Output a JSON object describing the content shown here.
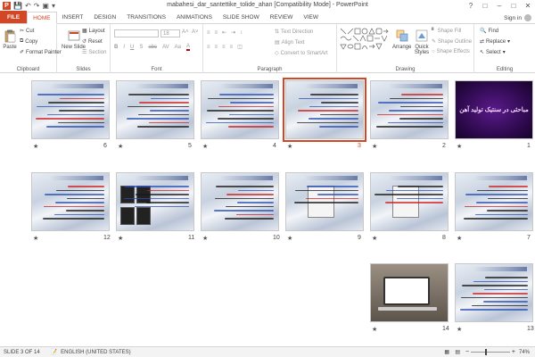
{
  "window": {
    "title": "mabahesi_dar_santettike_tolide_ahan [Compatibility Mode] - PowerPoint",
    "app_icon": "P"
  },
  "tabs": [
    {
      "label": "FILE"
    },
    {
      "label": "HOME"
    },
    {
      "label": "INSERT"
    },
    {
      "label": "DESIGN"
    },
    {
      "label": "TRANSITIONS"
    },
    {
      "label": "ANIMATIONS"
    },
    {
      "label": "SLIDE SHOW"
    },
    {
      "label": "REVIEW"
    },
    {
      "label": "VIEW"
    }
  ],
  "active_tab": "HOME",
  "signin": "Sign in",
  "ribbon": {
    "clipboard": {
      "label": "Clipboard",
      "paste": "Paste",
      "cut": "Cut",
      "copy": "Copy",
      "format_painter": "Format Painter"
    },
    "slides": {
      "label": "Slides",
      "new_slide": "New Slide",
      "layout": "Layout",
      "reset": "Reset",
      "section": "Section"
    },
    "font": {
      "label": "Font",
      "size": "18"
    },
    "paragraph": {
      "label": "Paragraph",
      "text_direction": "Text Direction",
      "align_text": "Align Text",
      "convert": "Convert to SmartArt"
    },
    "drawing": {
      "label": "Drawing",
      "arrange": "Arrange",
      "quick_styles": "Quick Styles",
      "shape_fill": "Shape Fill",
      "shape_outline": "Shape Outline",
      "shape_effects": "Shape Effects"
    },
    "editing": {
      "label": "Editing",
      "find": "Find",
      "replace": "Replace",
      "select": "Select"
    }
  },
  "slides": [
    {
      "num": "1",
      "kind": "title",
      "title": "مباحثی در سنتیک تولید آهن"
    },
    {
      "num": "2",
      "kind": "text"
    },
    {
      "num": "3",
      "kind": "text",
      "selected": true
    },
    {
      "num": "4",
      "kind": "text"
    },
    {
      "num": "5",
      "kind": "text"
    },
    {
      "num": "6",
      "kind": "text"
    },
    {
      "num": "7",
      "kind": "text"
    },
    {
      "num": "8",
      "kind": "chart"
    },
    {
      "num": "9",
      "kind": "chart"
    },
    {
      "num": "10",
      "kind": "text"
    },
    {
      "num": "11",
      "kind": "images"
    },
    {
      "num": "12",
      "kind": "text"
    },
    {
      "num": "13",
      "kind": "text"
    },
    {
      "num": "14",
      "kind": "photo"
    }
  ],
  "status": {
    "slide_indicator": "SLIDE 3 OF 14",
    "language": "ENGLISH (UNITED STATES)",
    "zoom": "74%",
    "zoom_level": 0.74
  },
  "colors": {
    "accent": "#d24726",
    "selected_outline": "#d24726"
  }
}
